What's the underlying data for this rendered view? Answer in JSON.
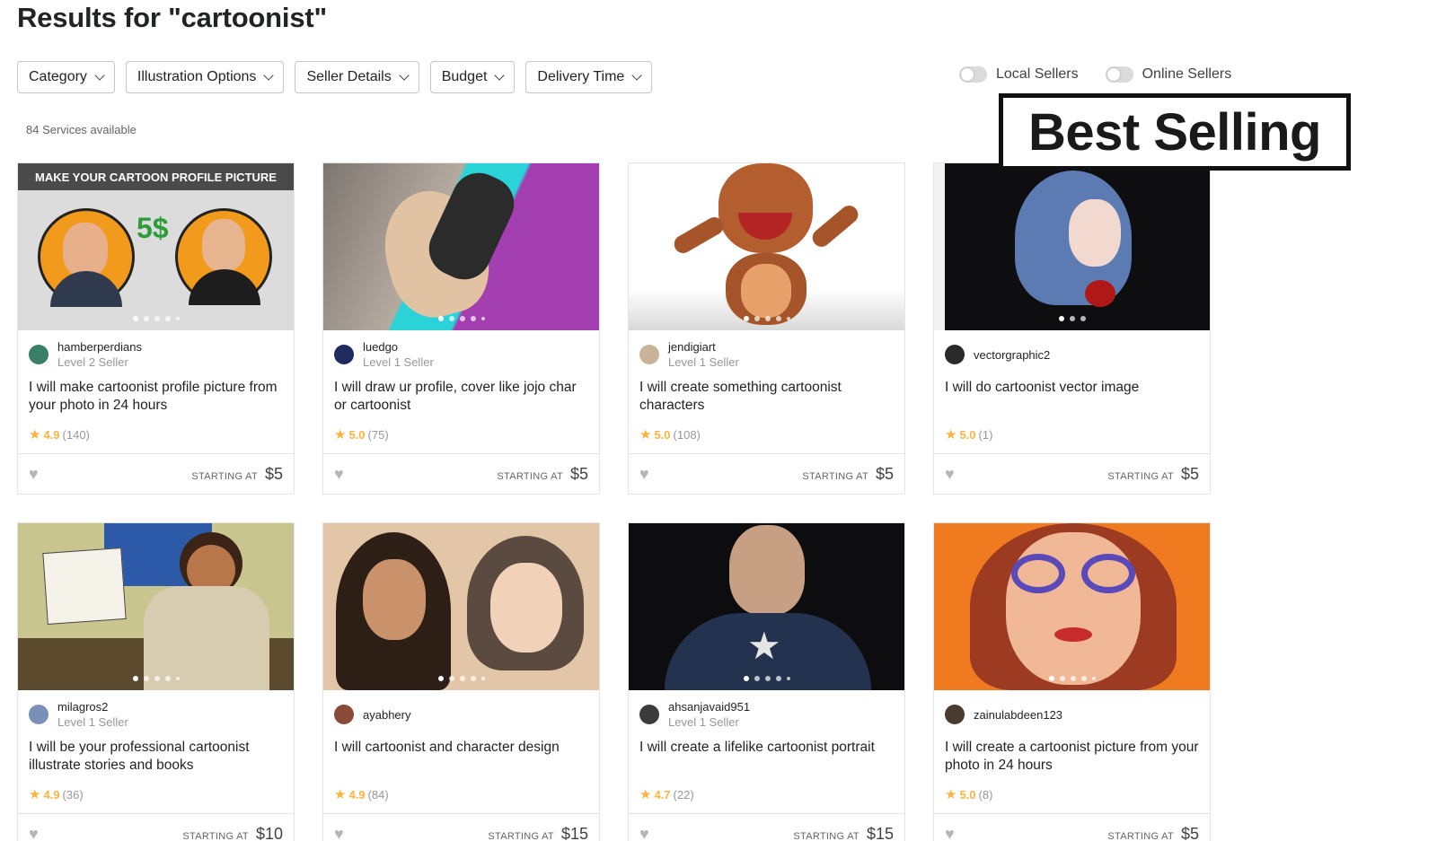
{
  "page": {
    "title": "Results for \"cartoonist\"",
    "services_available": "84 Services available",
    "sort_label": "Best Selling"
  },
  "filters": [
    {
      "label": "Category"
    },
    {
      "label": "Illustration Options"
    },
    {
      "label": "Seller Details"
    },
    {
      "label": "Budget"
    },
    {
      "label": "Delivery Time"
    }
  ],
  "toggles": [
    {
      "label": "Local Sellers",
      "on": false
    },
    {
      "label": "Online Sellers",
      "on": false
    }
  ],
  "starting_at_label": "STARTING AT",
  "gigs": [
    {
      "seller": "hamberperdians",
      "level": "Level 2 Seller",
      "title": "I will make cartoonist profile picture from your photo in 24 hours",
      "rating": "4.9",
      "reviews": "(140)",
      "price": "$5",
      "banner": "MAKE YOUR CARTOON PROFILE PICTURE",
      "banner_price": "5$"
    },
    {
      "seller": "luedgo",
      "level": "Level 1 Seller",
      "title": "I will draw ur profile, cover like jojo char or cartoonist",
      "rating": "5.0",
      "reviews": "(75)",
      "price": "$5"
    },
    {
      "seller": "jendigiart",
      "level": "Level 1 Seller",
      "title": "I will create something cartoonist characters",
      "rating": "5.0",
      "reviews": "(108)",
      "price": "$5"
    },
    {
      "seller": "vectorgraphic2",
      "level": "",
      "title": "I will do cartoonist vector image",
      "rating": "5.0",
      "reviews": "(1)",
      "price": "$5"
    },
    {
      "seller": "milagros2",
      "level": "Level 1 Seller",
      "title": "I will be your professional cartoonist illustrate stories and books",
      "rating": "4.9",
      "reviews": "(36)",
      "price": "$10"
    },
    {
      "seller": "ayabhery",
      "level": "",
      "title": "I will cartoonist and character design",
      "rating": "4.9",
      "reviews": "(84)",
      "price": "$15"
    },
    {
      "seller": "ahsanjavaid951",
      "level": "Level 1 Seller",
      "title": "I will create a lifelike cartoonist portrait",
      "rating": "4.7",
      "reviews": "(22)",
      "price": "$15"
    },
    {
      "seller": "zainulabdeen123",
      "level": "",
      "title": "I will create a cartoonist picture from your photo in 24 hours",
      "rating": "5.0",
      "reviews": "(8)",
      "price": "$5"
    }
  ],
  "colors": {
    "star": "#ffb33e",
    "border": "#e4e5e7",
    "text": "#222325",
    "muted": "#95979d"
  }
}
